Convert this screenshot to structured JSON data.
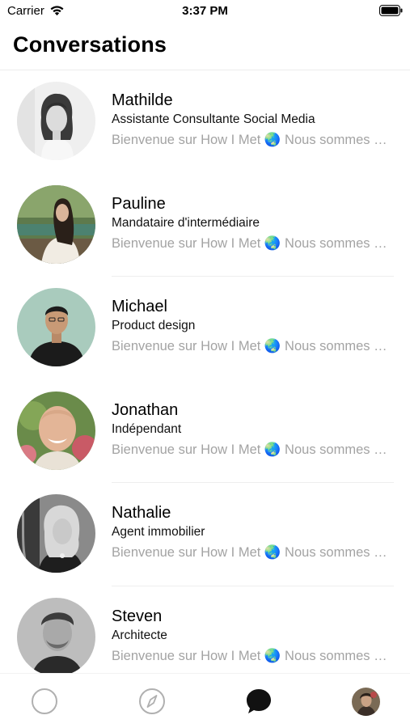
{
  "status_bar": {
    "carrier": "Carrier",
    "time": "3:37 PM"
  },
  "header": {
    "title": "Conversations"
  },
  "conversations": [
    {
      "name": "Mathilde",
      "title": "Assistante Consultante Social Media",
      "preview": "Bienvenue sur How I Met 🌏 Nous sommes ravis de vous compter parmi nous"
    },
    {
      "name": "Pauline",
      "title": "Mandataire d'intermédiaire",
      "preview": "Bienvenue sur How I Met 🌏 Nous sommes ravis de vous compter parmi nous"
    },
    {
      "name": "Michael",
      "title": "Product design",
      "preview": "Bienvenue sur How I Met 🌏 Nous sommes ravis de vous compter parmi nous"
    },
    {
      "name": "Jonathan",
      "title": "Indépendant",
      "preview": "Bienvenue sur How I Met 🌏 Nous sommes ravis de vous compter parmi nous"
    },
    {
      "name": "Nathalie",
      "title": "Agent immobilier",
      "preview": "Bienvenue sur How I Met 🌏 Nous sommes ravis de vous compter parmi nous"
    },
    {
      "name": "Steven",
      "title": "Architecte",
      "preview": "Bienvenue sur How I Met 🌏 Nous sommes ravis de vous compter parmi nous"
    }
  ],
  "tab_bar": {
    "tabs": [
      {
        "icon": "circle-icon",
        "active": false
      },
      {
        "icon": "compass-icon",
        "active": false
      },
      {
        "icon": "chat-bubble-icon",
        "active": true
      },
      {
        "icon": "profile-avatar",
        "active": false
      }
    ]
  },
  "colors": {
    "background": "#ffffff",
    "preview_text": "#a3a3a3",
    "divider": "#eeeeee",
    "inactive_icon": "#b0b0b0",
    "active_icon": "#111111"
  }
}
